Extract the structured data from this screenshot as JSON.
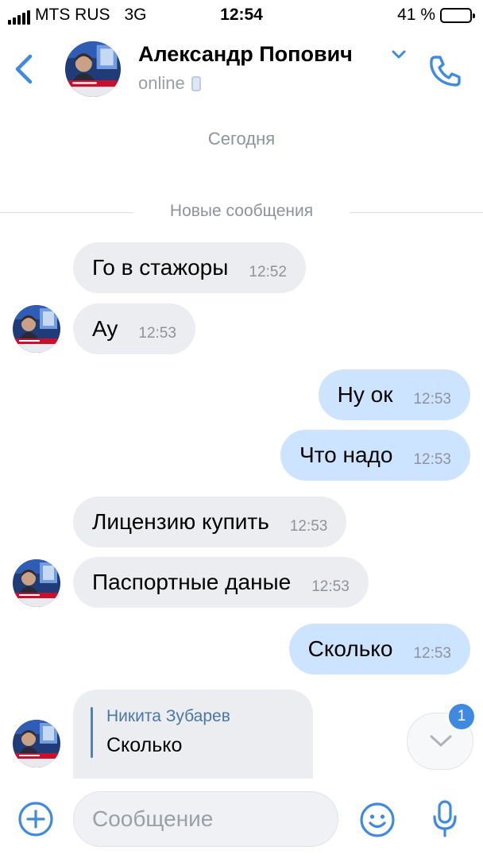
{
  "status_bar": {
    "carrier": "MTS RUS",
    "network": "3G",
    "time": "12:54",
    "battery": "41 %",
    "battery_level": 0.41
  },
  "header": {
    "contact_name": "Александр Попович",
    "status": "online",
    "back_icon": "chevron-left-icon",
    "call_icon": "phone-icon",
    "dropdown_icon": "chevron-down-icon"
  },
  "date_separator": "Сегодня",
  "new_messages_separator": "Новые сообщения",
  "messages": [
    {
      "direction": "in",
      "text": "Го в стажоры",
      "time": "12:52"
    },
    {
      "direction": "in",
      "text": "Ау",
      "time": "12:53"
    },
    {
      "direction": "out",
      "text": "Ну ок",
      "time": "12:53"
    },
    {
      "direction": "out",
      "text": "Что надо",
      "time": "12:53"
    },
    {
      "direction": "in",
      "text": "Лицензию купить",
      "time": "12:53"
    },
    {
      "direction": "in",
      "text": "Паспортные даные",
      "time": "12:53"
    },
    {
      "direction": "out",
      "text": "Сколько",
      "time": "12:53"
    }
  ],
  "reply_message": {
    "quoted_author": "Никита Зубарев",
    "quoted_text": "Сколько"
  },
  "scroll_down": {
    "unread_count": "1"
  },
  "composer": {
    "placeholder": "Сообщение"
  },
  "colors": {
    "accent": "#3f8ae0",
    "incoming_bubble": "#ebedf0",
    "outgoing_bubble": "#cce4ff"
  }
}
